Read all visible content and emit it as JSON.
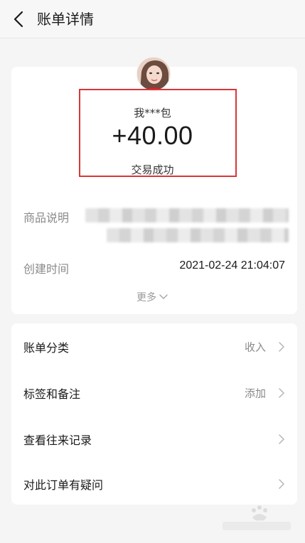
{
  "header": {
    "title": "账单详情"
  },
  "summary": {
    "merchant": "我***包",
    "amount": "+40.00",
    "status": "交易成功"
  },
  "details": {
    "product_label": "商品说明",
    "created_label": "创建时间",
    "created_value": "2021-02-24 21:04:07",
    "more_label": "更多"
  },
  "actions": [
    {
      "label": "账单分类",
      "value": "收入"
    },
    {
      "label": "标签和备注",
      "value": "添加"
    },
    {
      "label": "查看往来记录",
      "value": ""
    },
    {
      "label": "对此订单有疑问",
      "value": ""
    }
  ],
  "colors": {
    "highlight_border": "#d9363a",
    "background": "#f5f5f5",
    "card": "#ffffff",
    "muted_text": "#8a8a8a"
  }
}
